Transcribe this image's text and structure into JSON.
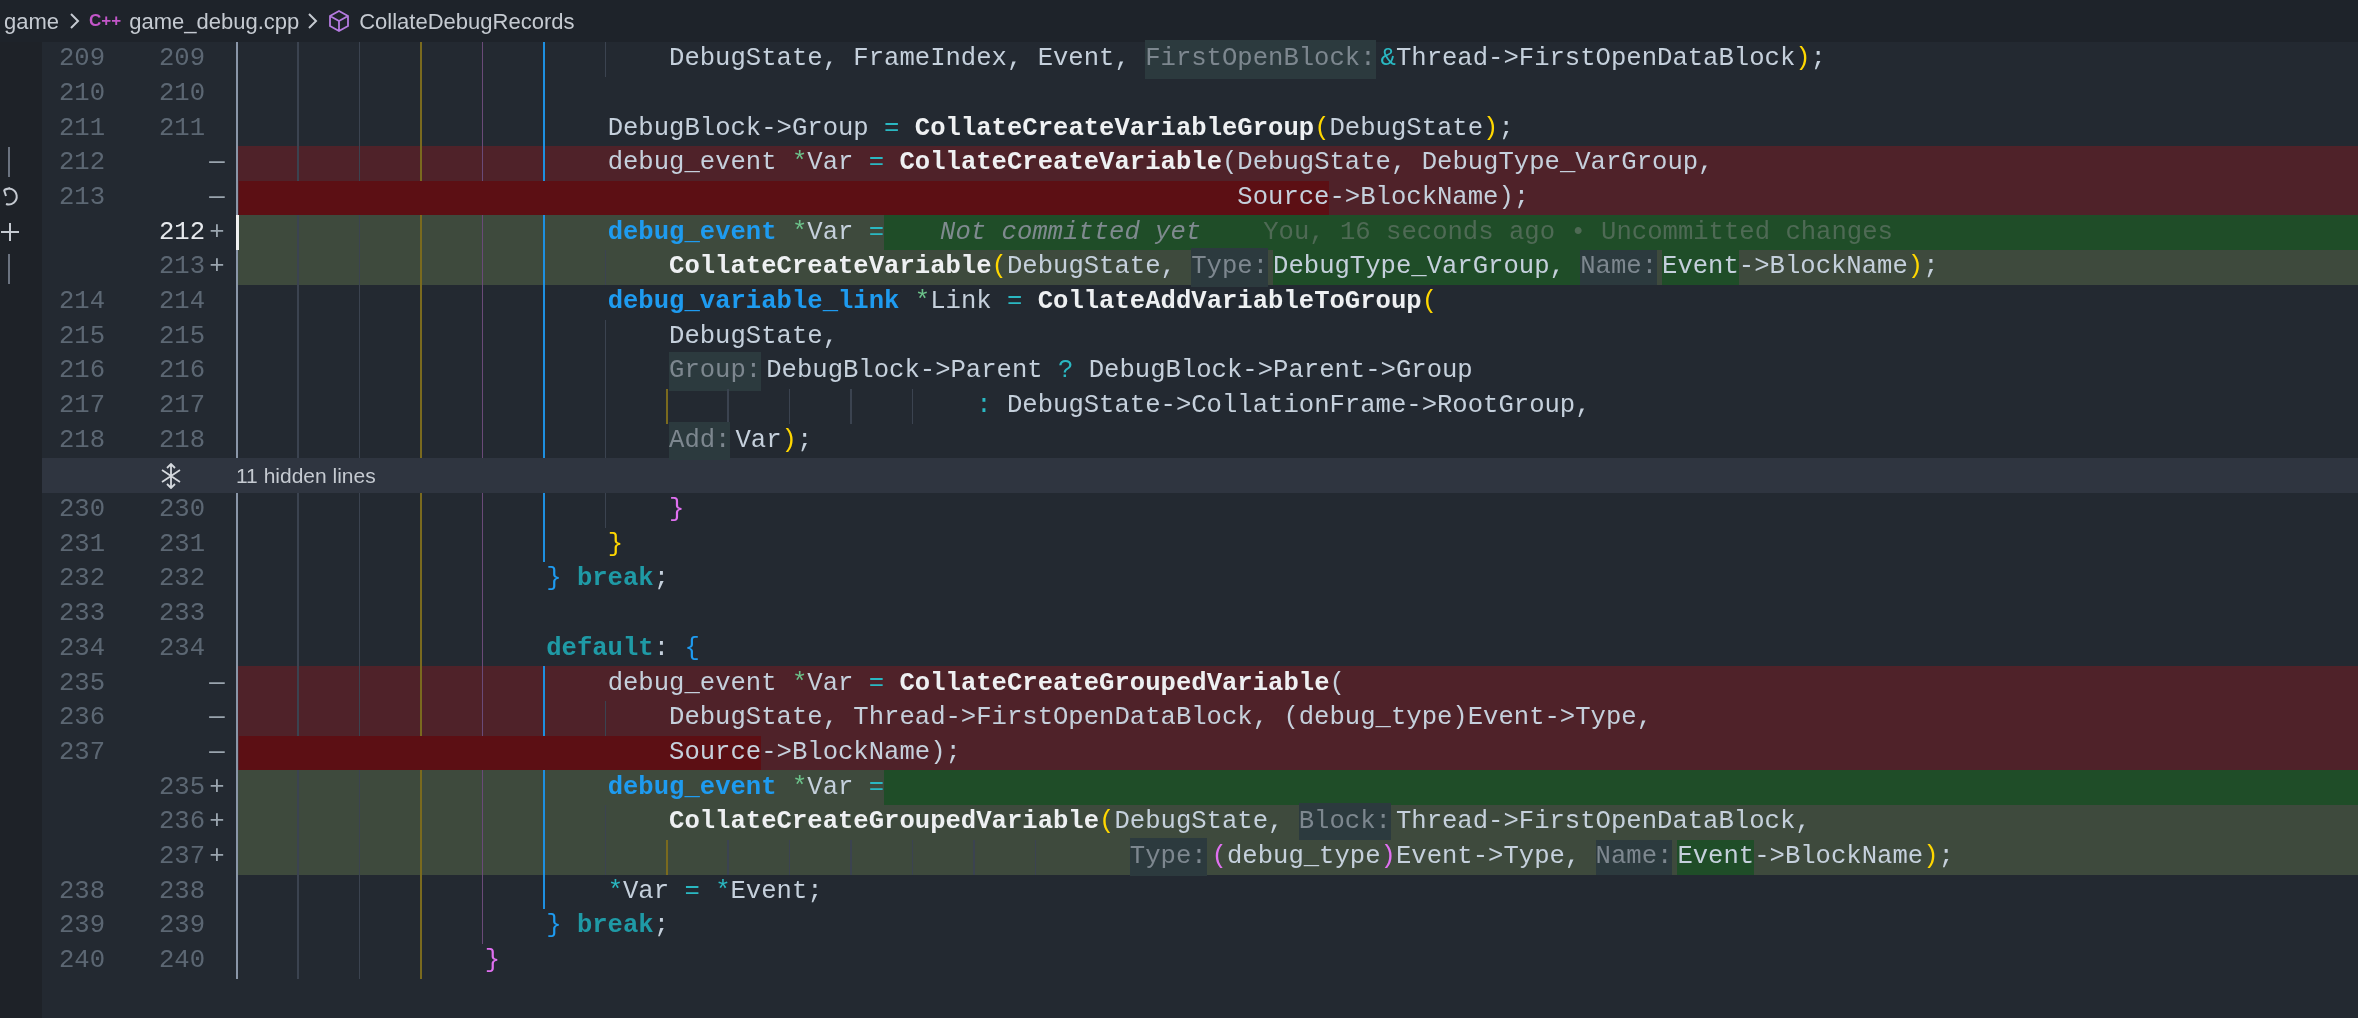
{
  "breadcrumb": {
    "folder": "game",
    "file_badge": "C++",
    "file": "game_debug.cpp",
    "symbol": "CollateDebugRecords"
  },
  "rows": [
    {
      "kind": "line",
      "old": "209",
      "new": "209",
      "removed": false,
      "added": false,
      "current": false,
      "highlight_rest": false,
      "tokens": [
        {
          "text": "                            DebugState, FrameIndex, Event, ",
          "kind": "plain",
          "highlighted": false
        },
        {
          "text": "FirstOpenBlock:",
          "kind": "hint",
          "highlighted": false
        },
        {
          "text": "&",
          "kind": "operator",
          "highlighted": false
        },
        {
          "text": "Thread->FirstOpenDataBlock",
          "kind": "plain",
          "highlighted": false
        },
        {
          "text": ")",
          "kind": "bracket1",
          "highlighted": false
        },
        {
          "text": ";",
          "kind": "plain",
          "highlighted": false
        }
      ]
    },
    {
      "kind": "line",
      "old": "210",
      "new": "210",
      "removed": false,
      "added": false,
      "current": false,
      "highlight_rest": false
    },
    {
      "kind": "line",
      "old": "211",
      "new": "211",
      "removed": false,
      "added": false,
      "current": false,
      "highlight_rest": false,
      "tokens": [
        {
          "text": "                        DebugBlock->Group ",
          "kind": "plain",
          "highlighted": false
        },
        {
          "text": "=",
          "kind": "operator",
          "highlighted": false
        },
        {
          "text": " CollateCreateVariableGroup",
          "kind": "function",
          "highlighted": false
        },
        {
          "text": "(",
          "kind": "bracket1",
          "highlighted": false
        },
        {
          "text": "DebugState",
          "kind": "plain",
          "highlighted": false
        },
        {
          "text": ")",
          "kind": "bracket1",
          "highlighted": false
        },
        {
          "text": ";",
          "kind": "plain",
          "highlighted": false
        }
      ]
    },
    {
      "kind": "line",
      "old": "212",
      "marker": "—",
      "removed": true,
      "added": false,
      "current": false,
      "highlight_rest": false,
      "tokens": [
        {
          "text": "                        debug_event ",
          "kind": "plain",
          "highlighted": false
        },
        {
          "text": "*",
          "kind": "pointer",
          "highlighted": false
        },
        {
          "text": "Var ",
          "kind": "plain",
          "highlighted": false
        },
        {
          "text": "=",
          "kind": "operator",
          "highlighted": false
        },
        {
          "text": " CollateCreateVariable",
          "kind": "function",
          "highlighted": false
        },
        {
          "text": "(DebugState, DebugType_VarGroup,",
          "kind": "plain",
          "highlighted": false
        }
      ]
    },
    {
      "kind": "line",
      "old": "213",
      "marker": "—",
      "removed": true,
      "added": false,
      "current": false,
      "highlight_rest": false,
      "tokens": [
        {
          "text": "                                                                 Source",
          "kind": "plain",
          "highlighted": true
        },
        {
          "text": "->BlockName);",
          "kind": "plain",
          "highlighted": false
        }
      ]
    },
    {
      "kind": "line",
      "new": "212",
      "marker": "+",
      "removed": false,
      "added": true,
      "current": true,
      "highlight_rest": true,
      "tokens": [
        {
          "text": "                        debug_event",
          "kind": "type",
          "highlighted": false
        },
        {
          "text": " *",
          "kind": "pointer",
          "highlighted": false
        },
        {
          "text": "Var ",
          "kind": "plain",
          "highlighted": false
        },
        {
          "text": "=",
          "kind": "operator",
          "highlighted": false
        }
      ],
      "blame": {
        "summary": "Not committed yet",
        "detail": "You, 16 seconds ago • Uncommitted changes"
      }
    },
    {
      "kind": "line",
      "new": "213",
      "marker": "+",
      "removed": false,
      "added": true,
      "current": false,
      "highlight_rest": false,
      "tokens": [
        {
          "text": "                            CollateCreateVariable",
          "kind": "function",
          "highlighted": false
        },
        {
          "text": "(",
          "kind": "bracket1",
          "highlighted": false
        },
        {
          "text": "DebugState, ",
          "kind": "plain",
          "highlighted": false
        },
        {
          "text": "Type:",
          "kind": "hint",
          "highlighted": false
        },
        {
          "text": "DebugType_VarGroup, ",
          "kind": "plain",
          "highlighted": true
        },
        {
          "text": "Name:",
          "kind": "hint",
          "highlighted": true
        },
        {
          "text": "Event",
          "kind": "plain",
          "highlighted": true
        },
        {
          "text": "->BlockName",
          "kind": "plain",
          "highlighted": false
        },
        {
          "text": ")",
          "kind": "bracket1",
          "highlighted": false
        },
        {
          "text": ";",
          "kind": "plain",
          "highlighted": false
        }
      ]
    },
    {
      "kind": "line",
      "old": "214",
      "new": "214",
      "removed": false,
      "added": false,
      "current": false,
      "highlight_rest": false,
      "tokens": [
        {
          "text": "                        debug_variable_link",
          "kind": "type",
          "highlighted": false
        },
        {
          "text": " *",
          "kind": "pointer",
          "highlighted": false
        },
        {
          "text": "Link ",
          "kind": "plain",
          "highlighted": false
        },
        {
          "text": "=",
          "kind": "operator",
          "highlighted": false
        },
        {
          "text": " CollateAddVariableToGroup",
          "kind": "function",
          "highlighted": false
        },
        {
          "text": "(",
          "kind": "bracket1",
          "highlighted": false
        }
      ]
    },
    {
      "kind": "line",
      "old": "215",
      "new": "215",
      "removed": false,
      "added": false,
      "current": false,
      "highlight_rest": false,
      "tokens": [
        {
          "text": "                            DebugState,",
          "kind": "plain",
          "highlighted": false
        }
      ]
    },
    {
      "kind": "line",
      "old": "216",
      "new": "216",
      "removed": false,
      "added": false,
      "current": false,
      "highlight_rest": false,
      "tokens": [
        {
          "text": "                            Group:",
          "kind": "hint",
          "highlighted": false
        },
        {
          "text": "DebugBlock->Parent ",
          "kind": "plain",
          "highlighted": false
        },
        {
          "text": "?",
          "kind": "operator",
          "highlighted": false
        },
        {
          "text": " DebugBlock->Parent->Group",
          "kind": "plain",
          "highlighted": false
        }
      ]
    },
    {
      "kind": "line",
      "old": "217",
      "new": "217",
      "removed": false,
      "added": false,
      "current": false,
      "highlight_rest": false,
      "tokens": [
        {
          "text": "                                                :",
          "kind": "operator",
          "highlighted": false
        },
        {
          "text": " DebugState->CollationFrame->RootGroup,",
          "kind": "plain",
          "highlighted": false
        }
      ]
    },
    {
      "kind": "line",
      "old": "218",
      "new": "218",
      "removed": false,
      "added": false,
      "current": false,
      "highlight_rest": false,
      "tokens": [
        {
          "text": "                            Add:",
          "kind": "hint",
          "highlighted": false
        },
        {
          "text": "Var",
          "kind": "plain",
          "highlighted": false
        },
        {
          "text": ")",
          "kind": "bracket1",
          "highlighted": false
        },
        {
          "text": ";",
          "kind": "plain",
          "highlighted": false
        }
      ]
    },
    {
      "kind": "fold",
      "label": "11 hidden lines"
    },
    {
      "kind": "line",
      "old": "230",
      "new": "230",
      "removed": false,
      "added": false,
      "current": false,
      "highlight_rest": false,
      "tokens": [
        {
          "text": "                            }",
          "kind": "bracket2",
          "highlighted": false
        }
      ]
    },
    {
      "kind": "line",
      "old": "231",
      "new": "231",
      "removed": false,
      "added": false,
      "current": false,
      "highlight_rest": false,
      "tokens": [
        {
          "text": "                        }",
          "kind": "bracket1",
          "highlighted": false
        }
      ]
    },
    {
      "kind": "line",
      "old": "232",
      "new": "232",
      "removed": false,
      "added": false,
      "current": false,
      "highlight_rest": false,
      "tokens": [
        {
          "text": "                    }",
          "kind": "bracket3",
          "highlighted": false
        },
        {
          "text": " break",
          "kind": "keyword",
          "highlighted": false
        },
        {
          "text": ";",
          "kind": "plain",
          "highlighted": false
        }
      ]
    },
    {
      "kind": "line",
      "old": "233",
      "new": "233",
      "removed": false,
      "added": false,
      "current": false,
      "highlight_rest": false
    },
    {
      "kind": "line",
      "old": "234",
      "new": "234",
      "removed": false,
      "added": false,
      "current": false,
      "highlight_rest": false,
      "tokens": [
        {
          "text": "                    default",
          "kind": "keyword",
          "highlighted": false
        },
        {
          "text": ": ",
          "kind": "plain",
          "highlighted": false
        },
        {
          "text": "{",
          "kind": "bracket3",
          "highlighted": false
        }
      ]
    },
    {
      "kind": "line",
      "old": "235",
      "marker": "—",
      "removed": true,
      "added": false,
      "current": false,
      "highlight_rest": false,
      "tokens": [
        {
          "text": "                        debug_event ",
          "kind": "plain",
          "highlighted": false
        },
        {
          "text": "*",
          "kind": "pointer",
          "highlighted": false
        },
        {
          "text": "Var ",
          "kind": "plain",
          "highlighted": false
        },
        {
          "text": "=",
          "kind": "operator",
          "highlighted": false
        },
        {
          "text": " CollateCreateGroupedVariable",
          "kind": "function",
          "highlighted": false
        },
        {
          "text": "(",
          "kind": "plain",
          "highlighted": false
        }
      ]
    },
    {
      "kind": "line",
      "old": "236",
      "marker": "—",
      "removed": true,
      "added": false,
      "current": false,
      "highlight_rest": false,
      "tokens": [
        {
          "text": "                            DebugState, Thread->FirstOpenDataBlock, (debug_type)Event->Type,",
          "kind": "plain",
          "highlighted": false
        }
      ]
    },
    {
      "kind": "line",
      "old": "237",
      "marker": "—",
      "removed": true,
      "added": false,
      "current": false,
      "highlight_rest": false,
      "tokens": [
        {
          "text": "                            Source",
          "kind": "plain",
          "highlighted": true
        },
        {
          "text": "->BlockName);",
          "kind": "plain",
          "highlighted": false
        }
      ]
    },
    {
      "kind": "line",
      "new": "235",
      "marker": "+",
      "removed": false,
      "added": true,
      "current": false,
      "highlight_rest": true,
      "tokens": [
        {
          "text": "                        debug_event",
          "kind": "type",
          "highlighted": false
        },
        {
          "text": " *",
          "kind": "pointer",
          "highlighted": false
        },
        {
          "text": "Var ",
          "kind": "plain",
          "highlighted": false
        },
        {
          "text": "=",
          "kind": "operator",
          "highlighted": false
        }
      ]
    },
    {
      "kind": "line",
      "new": "236",
      "marker": "+",
      "removed": false,
      "added": true,
      "current": false,
      "highlight_rest": false,
      "tokens": [
        {
          "text": "                            CollateCreateGroupedVariable",
          "kind": "function",
          "highlighted": false
        },
        {
          "text": "(",
          "kind": "bracket1",
          "highlighted": false
        },
        {
          "text": "DebugState, ",
          "kind": "plain",
          "highlighted": false
        },
        {
          "text": "Block:",
          "kind": "hint",
          "highlighted": false
        },
        {
          "text": "Thread->FirstOpenDataBlock,",
          "kind": "plain",
          "highlighted": false
        }
      ]
    },
    {
      "kind": "line",
      "new": "237",
      "marker": "+",
      "removed": false,
      "added": true,
      "current": false,
      "highlight_rest": false,
      "tokens": [
        {
          "text": "                                                          Type:",
          "kind": "hint",
          "highlighted": false
        },
        {
          "text": "(",
          "kind": "bracket2",
          "highlighted": false
        },
        {
          "text": "debug_type",
          "kind": "plain",
          "highlighted": false
        },
        {
          "text": ")",
          "kind": "bracket2",
          "highlighted": false
        },
        {
          "text": "Event->Type, ",
          "kind": "plain",
          "highlighted": false
        },
        {
          "text": "Name:",
          "kind": "hint",
          "highlighted": true
        },
        {
          "text": "Event",
          "kind": "plain",
          "highlighted": true
        },
        {
          "text": "->BlockName",
          "kind": "plain",
          "highlighted": false
        },
        {
          "text": ")",
          "kind": "bracket1",
          "highlighted": false
        },
        {
          "text": ";",
          "kind": "plain",
          "highlighted": false
        }
      ]
    },
    {
      "kind": "line",
      "old": "238",
      "new": "238",
      "removed": false,
      "added": false,
      "current": false,
      "highlight_rest": false,
      "tokens": [
        {
          "text": "                        *",
          "kind": "operator",
          "highlighted": false
        },
        {
          "text": "Var ",
          "kind": "plain",
          "highlighted": false
        },
        {
          "text": "=",
          "kind": "operator",
          "highlighted": false
        },
        {
          "text": " *",
          "kind": "operator",
          "highlighted": false
        },
        {
          "text": "Event;",
          "kind": "plain",
          "highlighted": false
        }
      ]
    },
    {
      "kind": "line",
      "old": "239",
      "new": "239",
      "removed": false,
      "added": false,
      "current": false,
      "highlight_rest": false,
      "tokens": [
        {
          "text": "                    }",
          "kind": "bracket3",
          "highlighted": false
        },
        {
          "text": " break",
          "kind": "keyword",
          "highlighted": false
        },
        {
          "text": ";",
          "kind": "plain",
          "highlighted": false
        }
      ]
    },
    {
      "kind": "line",
      "old": "240",
      "new": "240",
      "removed": false,
      "added": false,
      "current": false,
      "highlight_rest": false,
      "tokens": [
        {
          "text": "                }",
          "kind": "bracket2",
          "highlighted": false
        }
      ]
    }
  ]
}
